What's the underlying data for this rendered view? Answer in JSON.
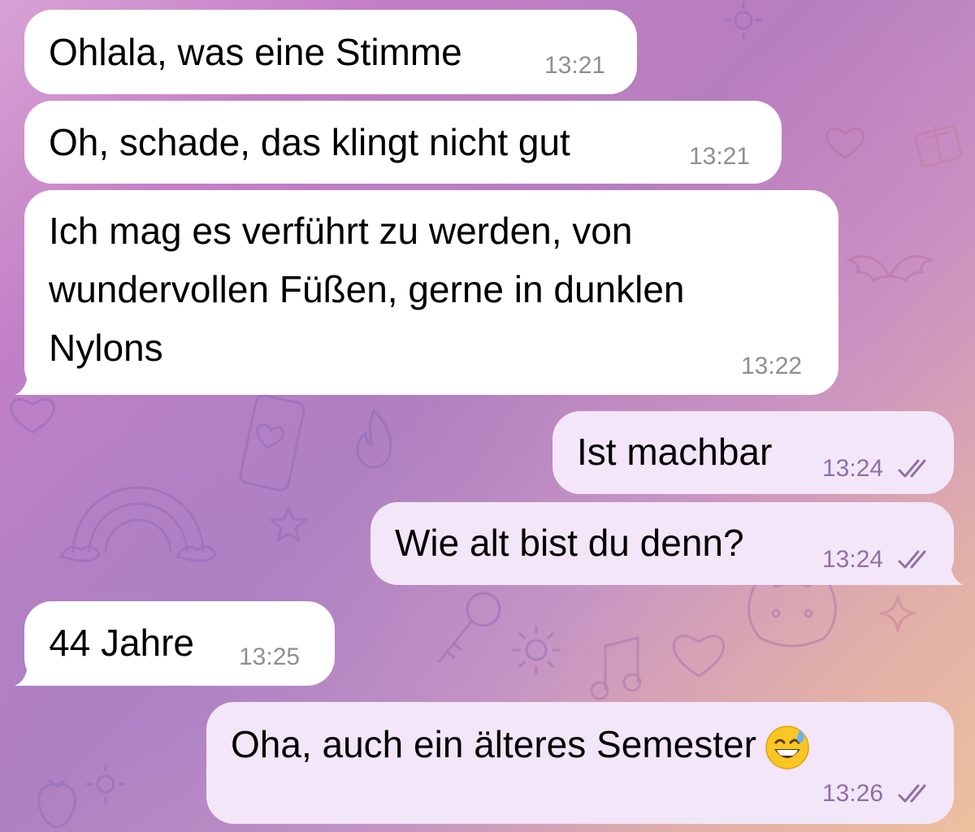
{
  "colors": {
    "incoming_bubble": "#ffffff",
    "outgoing_bubble": "#f3e6f8",
    "incoming_time": "#8f8f93",
    "outgoing_time": "#8f70a6",
    "background_start": "#d7a2d4",
    "background_end": "#eebf9e"
  },
  "messages": [
    {
      "direction": "incoming",
      "text": "Ohlala, was eine Stimme",
      "time": "13:21"
    },
    {
      "direction": "incoming",
      "text": "Oh, schade, das klingt nicht gut",
      "time": "13:21"
    },
    {
      "direction": "incoming",
      "lines": [
        "Ich mag es verführt zu werden, von",
        "wundervollen Füßen, gerne in dunklen",
        "Nylons"
      ],
      "time": "13:22"
    },
    {
      "direction": "outgoing",
      "text": "Ist machbar",
      "time": "13:24",
      "status_icon": "double-check-icon"
    },
    {
      "direction": "outgoing",
      "text": "Wie alt bist du denn?",
      "time": "13:24",
      "status_icon": "double-check-icon"
    },
    {
      "direction": "incoming",
      "text": "44 Jahre",
      "time": "13:25"
    },
    {
      "direction": "outgoing",
      "text": "Oha,  auch ein älteres Semester",
      "emoji": "grinning-face-with-sweat-emoji",
      "time": "13:26",
      "status_icon": "double-check-icon"
    }
  ]
}
